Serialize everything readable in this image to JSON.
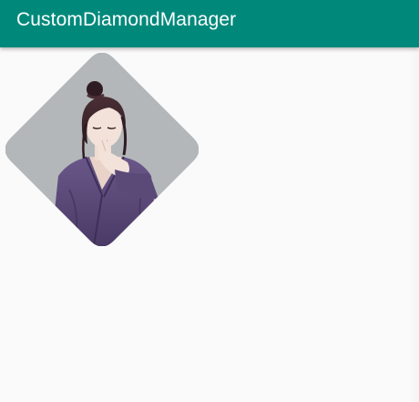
{
  "toolbar": {
    "title": "CustomDiamondManager"
  },
  "colors": {
    "toolbar": "#00897b",
    "background": "#fafafa",
    "image_background": "#b3b7b9",
    "robe": "#5d4c7a"
  },
  "image": {
    "subject": "anime-character-portrait"
  }
}
